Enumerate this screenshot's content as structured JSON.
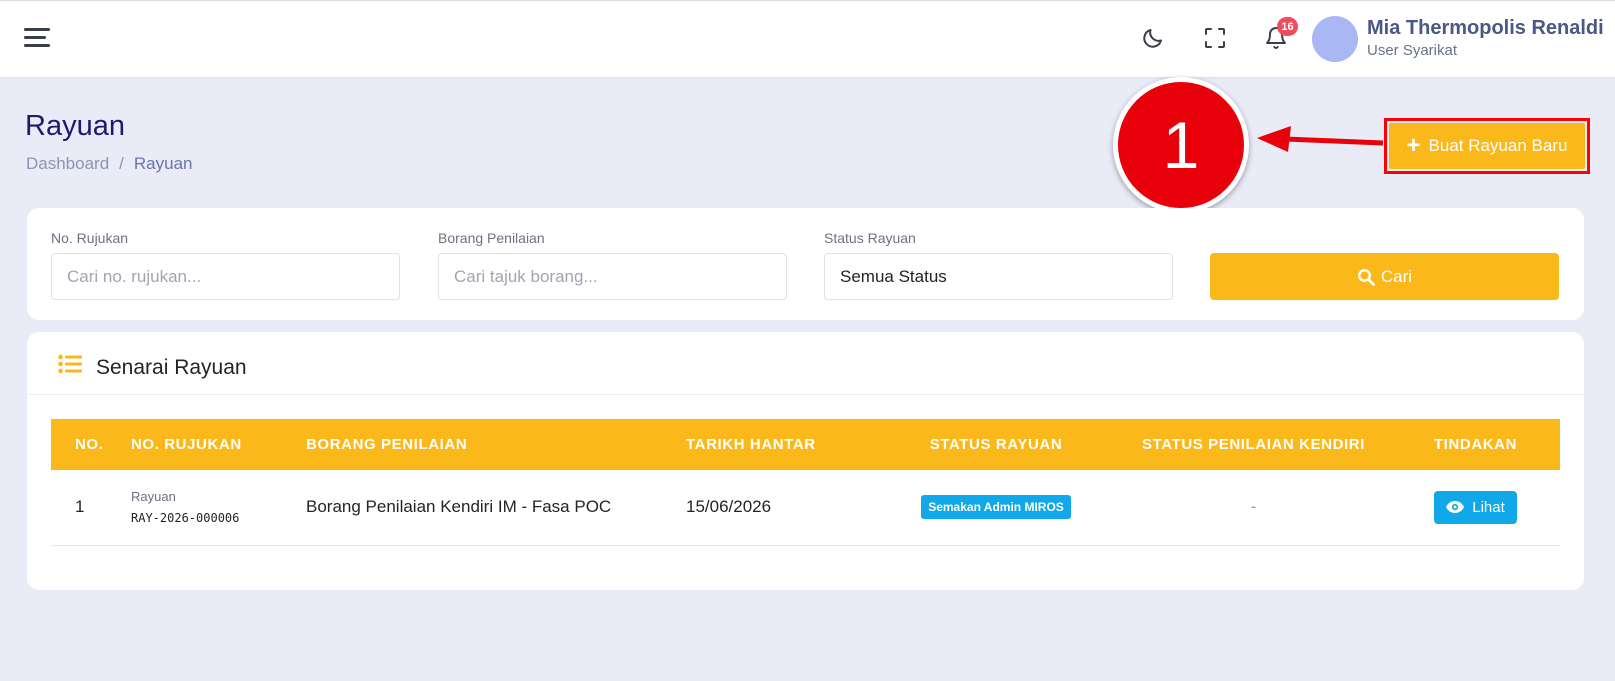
{
  "topbar": {
    "menu_icon": "hamburger-icon",
    "theme_icon": "moon-icon",
    "fullscreen_icon": "fullscreen-icon",
    "notification_icon": "bell-icon",
    "notification_count": "16",
    "user_name": "Mia Thermopolis Renaldi",
    "user_role": "User Syarikat"
  },
  "page": {
    "title": "Rayuan",
    "breadcrumb": [
      "Dashboard",
      "Rayuan"
    ],
    "create_button_label": "Buat Rayuan Baru",
    "annotation_number": "1"
  },
  "filters": {
    "ref_label": "No. Rujukan",
    "ref_placeholder": "Cari no. rujukan...",
    "form_label": "Borang Penilaian",
    "form_placeholder": "Cari tajuk borang...",
    "status_label": "Status Rayuan",
    "status_value": "Semua Status",
    "search_button_label": "Cari"
  },
  "list": {
    "title": "Senarai Rayuan",
    "columns": [
      "NO.",
      "NO. RUJUKAN",
      "BORANG PENILAIAN",
      "TARIKH HANTAR",
      "STATUS RAYUAN",
      "STATUS PENILAIAN KENDIRI",
      "TINDAKAN"
    ],
    "rows": [
      {
        "no": "1",
        "ref_type": "Rayuan",
        "ref_code": "RAY-2026-000006",
        "form": "Borang Penilaian Kendiri IM - Fasa POC",
        "date": "15/06/2026",
        "status": "Semakan Admin MIROS",
        "self_status": "-",
        "action_label": "Lihat"
      }
    ]
  },
  "colors": {
    "accent": "#fbb81a",
    "info": "#10a8e8",
    "annotation": "#e8000b",
    "background": "#e9ebf7"
  }
}
